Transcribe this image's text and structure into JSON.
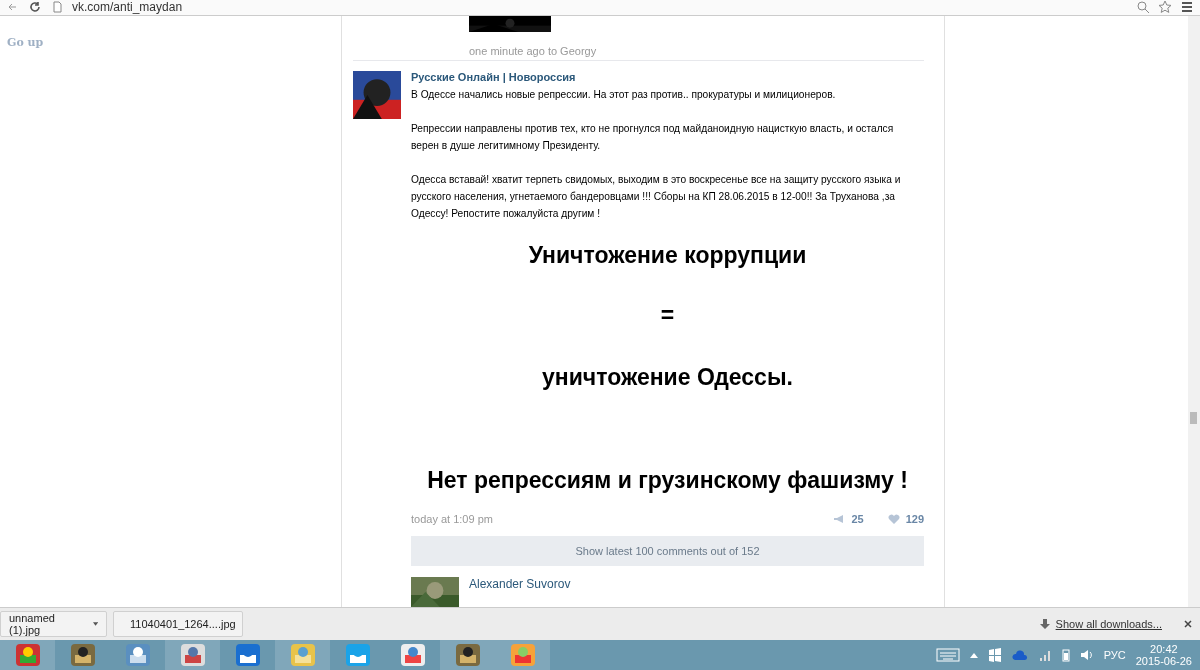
{
  "browser": {
    "url": "vk.com/anti_maydan"
  },
  "sidebar": {
    "go_up": "Go up"
  },
  "previous_post": {
    "caption": "one minute ago to Georgy"
  },
  "post": {
    "author": "Русские Онлайн | Новороссия",
    "paragraphs": [
      [
        "В Одессе начались новые репрессии. На этот раз против.. прокуратуры и милиционеров."
      ],
      [
        "Репрессии направлены против тех, кто не прогнулся под майданоидную нацисткую власть, и остался",
        "верен в душе легитимному Президенту."
      ],
      [
        "Одесса вставай! хватит терпеть свидомых, выходим в это воскресенье все на защиту русского языка и",
        "русского населения, угнетаемого бандеровцами !!! Сборы на КП 28.06.2015 в 12-00!! За Труханова ,за",
        "Одессу! Репостите пожалуйста другим !"
      ]
    ],
    "image_lines": [
      "Уничтожение коррупции",
      "=",
      "уничтожение Одессы.",
      "Нет репрессиям и грузинскому фашизму !"
    ],
    "time": "today at 1:09 pm",
    "reposts": "25",
    "likes": "129",
    "show_comments": "Show latest 100 comments out of 152",
    "comment_author": "Alexander Suvorov"
  },
  "downloads": {
    "items": [
      "unnamed (1).jpg",
      "11040401_1264....jpg"
    ],
    "show_all": "Show all downloads..."
  },
  "taskbar": {
    "language": "РУС",
    "time": "20:42",
    "date": "2015-06-26"
  }
}
